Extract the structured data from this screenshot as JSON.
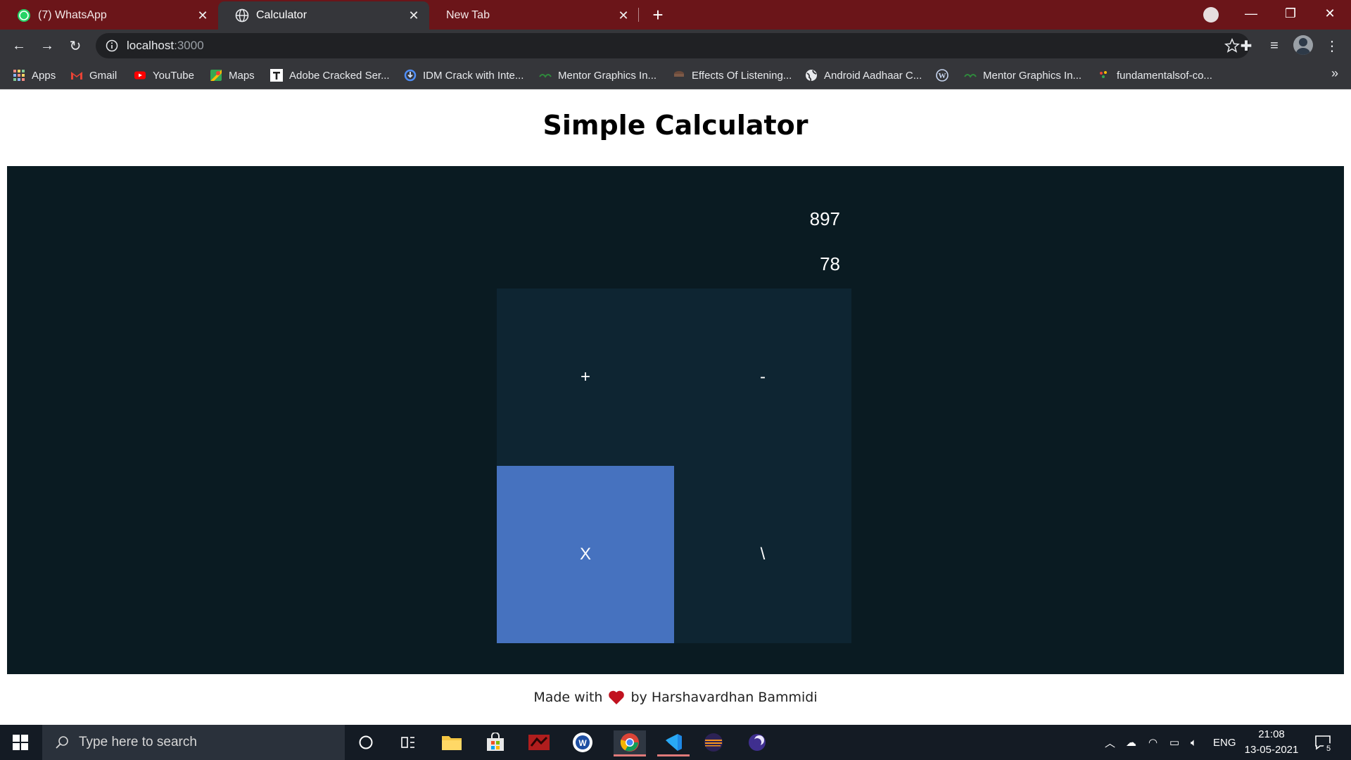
{
  "browser": {
    "tabs": [
      {
        "title": "(7) WhatsApp",
        "icon": "whatsapp-icon",
        "active": false
      },
      {
        "title": "Calculator",
        "icon": "globe-icon",
        "active": true
      },
      {
        "title": "New Tab",
        "icon": "",
        "active": false
      }
    ],
    "url_host": "localhost",
    "url_port": ":3000",
    "bookmarks": [
      {
        "label": "Apps",
        "icon": "apps-grid-icon"
      },
      {
        "label": "Gmail",
        "icon": "gmail-icon"
      },
      {
        "label": "YouTube",
        "icon": "youtube-icon"
      },
      {
        "label": "Maps",
        "icon": "maps-icon"
      },
      {
        "label": "Adobe Cracked Ser...",
        "icon": "t-logo-icon"
      },
      {
        "label": "IDM Crack with Inte...",
        "icon": "idm-icon"
      },
      {
        "label": "Mentor Graphics In...",
        "icon": "mentor-icon"
      },
      {
        "label": "Effects Of Listening...",
        "icon": "page-icon"
      },
      {
        "label": "Android Aadhaar C...",
        "icon": "globe-icon"
      },
      {
        "label": "",
        "icon": "wordpress-icon"
      },
      {
        "label": "Mentor Graphics In...",
        "icon": "mentor-icon"
      },
      {
        "label": "fundamentalsof-co...",
        "icon": "dots-icon"
      }
    ],
    "bookmarks_overflow": "»"
  },
  "page": {
    "title": "Simple Calculator",
    "display": {
      "first_value": "897",
      "second_value": "78"
    },
    "keys": [
      {
        "label": "+",
        "name": "add-button",
        "active": false
      },
      {
        "label": "-",
        "name": "subtract-button",
        "active": false
      },
      {
        "label": "X",
        "name": "multiply-button",
        "active": true
      },
      {
        "label": "\\",
        "name": "divide-button",
        "active": false
      }
    ],
    "footer": {
      "prefix": "Made with",
      "suffix": "by Harshavardhan Bammidi"
    }
  },
  "taskbar": {
    "search_placeholder": "Type here to search",
    "language": "ENG",
    "time": "21:08",
    "date": "13-05-2021",
    "notification_count": "5"
  },
  "colors": {
    "tab_strip": "#6b1519",
    "panel_bg": "#0a1b22",
    "key_bg": "#0e2532",
    "key_active": "#4672bf"
  }
}
